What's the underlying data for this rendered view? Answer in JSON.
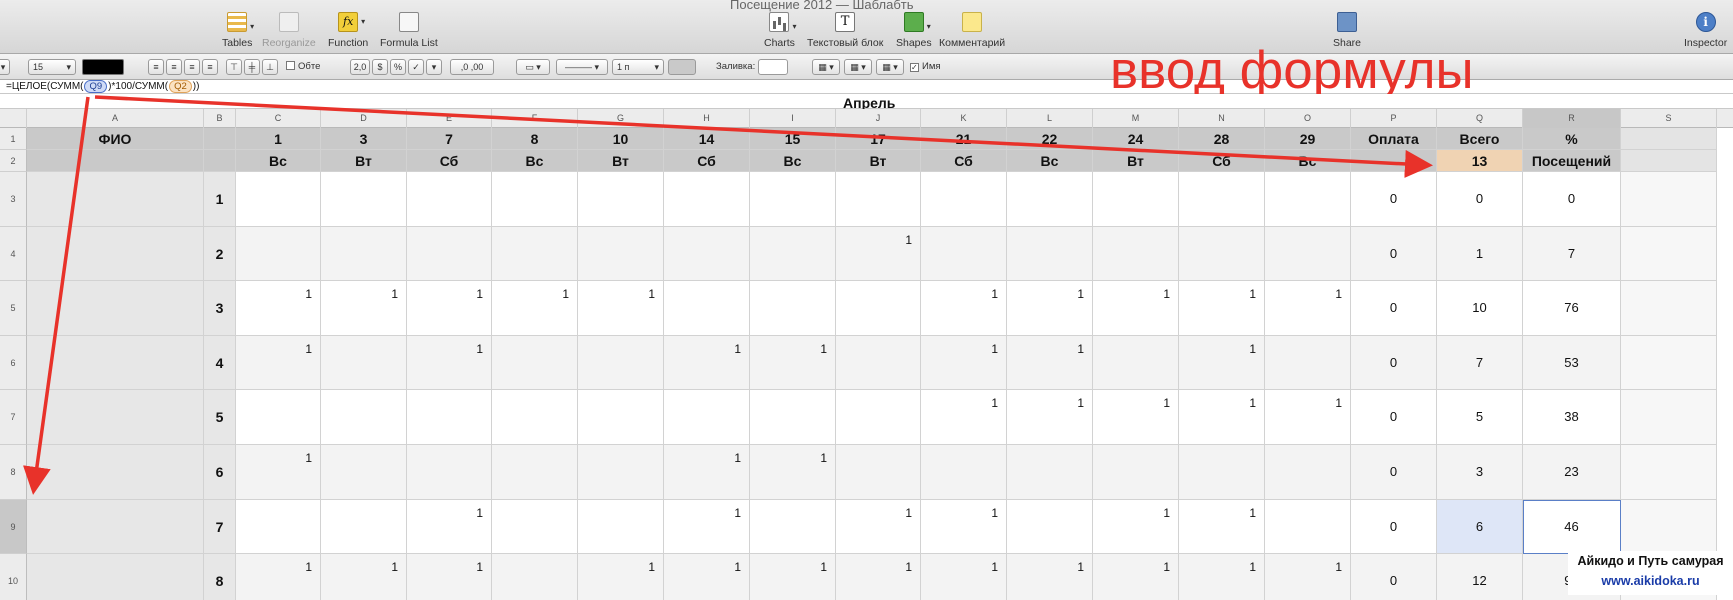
{
  "window": {
    "title": "Посещение 2012 — Шаблабть"
  },
  "toolbar": {
    "items": [
      {
        "label": "Tables",
        "icon": "tables-icon",
        "enabled": true
      },
      {
        "label": "Reorganize",
        "icon": "reorganize-icon",
        "enabled": false
      },
      {
        "label": "Function",
        "icon": "function-icon",
        "enabled": true
      },
      {
        "label": "Formula List",
        "icon": "formula-list-icon",
        "enabled": true
      },
      {
        "label": "Charts",
        "icon": "charts-icon",
        "enabled": true
      },
      {
        "label": "Текстовый блок",
        "icon": "text-box-icon",
        "enabled": true
      },
      {
        "label": "Shapes",
        "icon": "shapes-icon",
        "enabled": true
      },
      {
        "label": "Комментарий",
        "icon": "comment-icon",
        "enabled": true
      },
      {
        "label": "Share",
        "icon": "share-icon",
        "enabled": true
      },
      {
        "label": "Inspector",
        "icon": "inspector-icon",
        "enabled": true
      }
    ],
    "function_glyph": "fx",
    "text_glyph": "T",
    "inspector_glyph": "i"
  },
  "format_bar": {
    "font_size": "15",
    "text_color": "#000000",
    "wrap_label": "Обте",
    "number_formats": [
      "2,0",
      "$",
      "%",
      "✓",
      "▾"
    ],
    "decimals": ",0 ,00",
    "line_width": "1 п",
    "fill_label": "Заливка:",
    "name_label": "Имя"
  },
  "formula": {
    "prefix": "=ЦЕЛОЕ(СУММ(",
    "ref1": "Q9",
    "middle": ")*100/СУММ(",
    "ref2": "Q2",
    "suffix": "))"
  },
  "caption": "ввод формулы",
  "table": {
    "title": "Апрель",
    "columns": [
      "A",
      "B",
      "C",
      "D",
      "E",
      "F",
      "G",
      "H",
      "I",
      "J",
      "K",
      "L",
      "M",
      "N",
      "O",
      "P",
      "Q",
      "R",
      "S"
    ],
    "row_numbers": [
      "1",
      "2",
      "3",
      "4",
      "5",
      "6",
      "7",
      "8",
      "9",
      "10"
    ],
    "header1": [
      "ФИО",
      "",
      "1",
      "3",
      "7",
      "8",
      "10",
      "14",
      "15",
      "17",
      "21",
      "22",
      "24",
      "28",
      "29",
      "Оплата",
      "Всего",
      "%"
    ],
    "header2": [
      "",
      "",
      "Вс",
      "Вт",
      "Сб",
      "Вс",
      "Вт",
      "Сб",
      "Вс",
      "Вт",
      "Сб",
      "Вс",
      "Вт",
      "Сб",
      "Вс",
      "",
      "13",
      "Посещений"
    ],
    "rows": [
      {
        "idx": "1",
        "days": [
          "",
          "",
          "",
          "",
          "",
          "",
          "",
          "",
          "",
          "",
          "",
          "",
          ""
        ],
        "payment": "0",
        "total": "0",
        "percent": "0"
      },
      {
        "idx": "2",
        "days": [
          "",
          "",
          "",
          "",
          "",
          "",
          "",
          "1",
          "",
          "",
          "",
          "",
          ""
        ],
        "payment": "0",
        "total": "1",
        "percent": "7"
      },
      {
        "idx": "3",
        "days": [
          "1",
          "1",
          "1",
          "1",
          "1",
          "",
          "",
          "",
          "1",
          "1",
          "1",
          "1",
          "1"
        ],
        "payment": "0",
        "total": "10",
        "percent": "76"
      },
      {
        "idx": "4",
        "days": [
          "1",
          "",
          "1",
          "",
          "",
          "1",
          "1",
          "",
          "1",
          "1",
          "",
          "1",
          ""
        ],
        "payment": "0",
        "total": "7",
        "percent": "53"
      },
      {
        "idx": "5",
        "days": [
          "",
          "",
          "",
          "",
          "",
          "",
          "",
          "",
          "1",
          "1",
          "1",
          "1",
          "1"
        ],
        "payment": "0",
        "total": "5",
        "percent": "38"
      },
      {
        "idx": "6",
        "days": [
          "1",
          "",
          "",
          "",
          "",
          "1",
          "1",
          "",
          "",
          "",
          "",
          "",
          ""
        ],
        "payment": "0",
        "total": "3",
        "percent": "23"
      },
      {
        "idx": "7",
        "days": [
          "",
          "",
          "1",
          "",
          "",
          "1",
          "",
          "1",
          "1",
          "",
          "1",
          "1",
          ""
        ],
        "payment": "0",
        "total": "6",
        "percent": "46"
      },
      {
        "idx": "8",
        "days": [
          "1",
          "1",
          "1",
          "",
          "1",
          "1",
          "1",
          "1",
          "1",
          "1",
          "1",
          "1",
          "1"
        ],
        "payment": "0",
        "total": "12",
        "percent": "92"
      }
    ]
  },
  "watermark": {
    "line1": "Айкидо и Путь самурая",
    "line2": "www.aikidoka.ru"
  },
  "colors": {
    "arrow": "#e8322a",
    "selection": "#5a7fc7",
    "header_bg": "#c9c9c9"
  }
}
